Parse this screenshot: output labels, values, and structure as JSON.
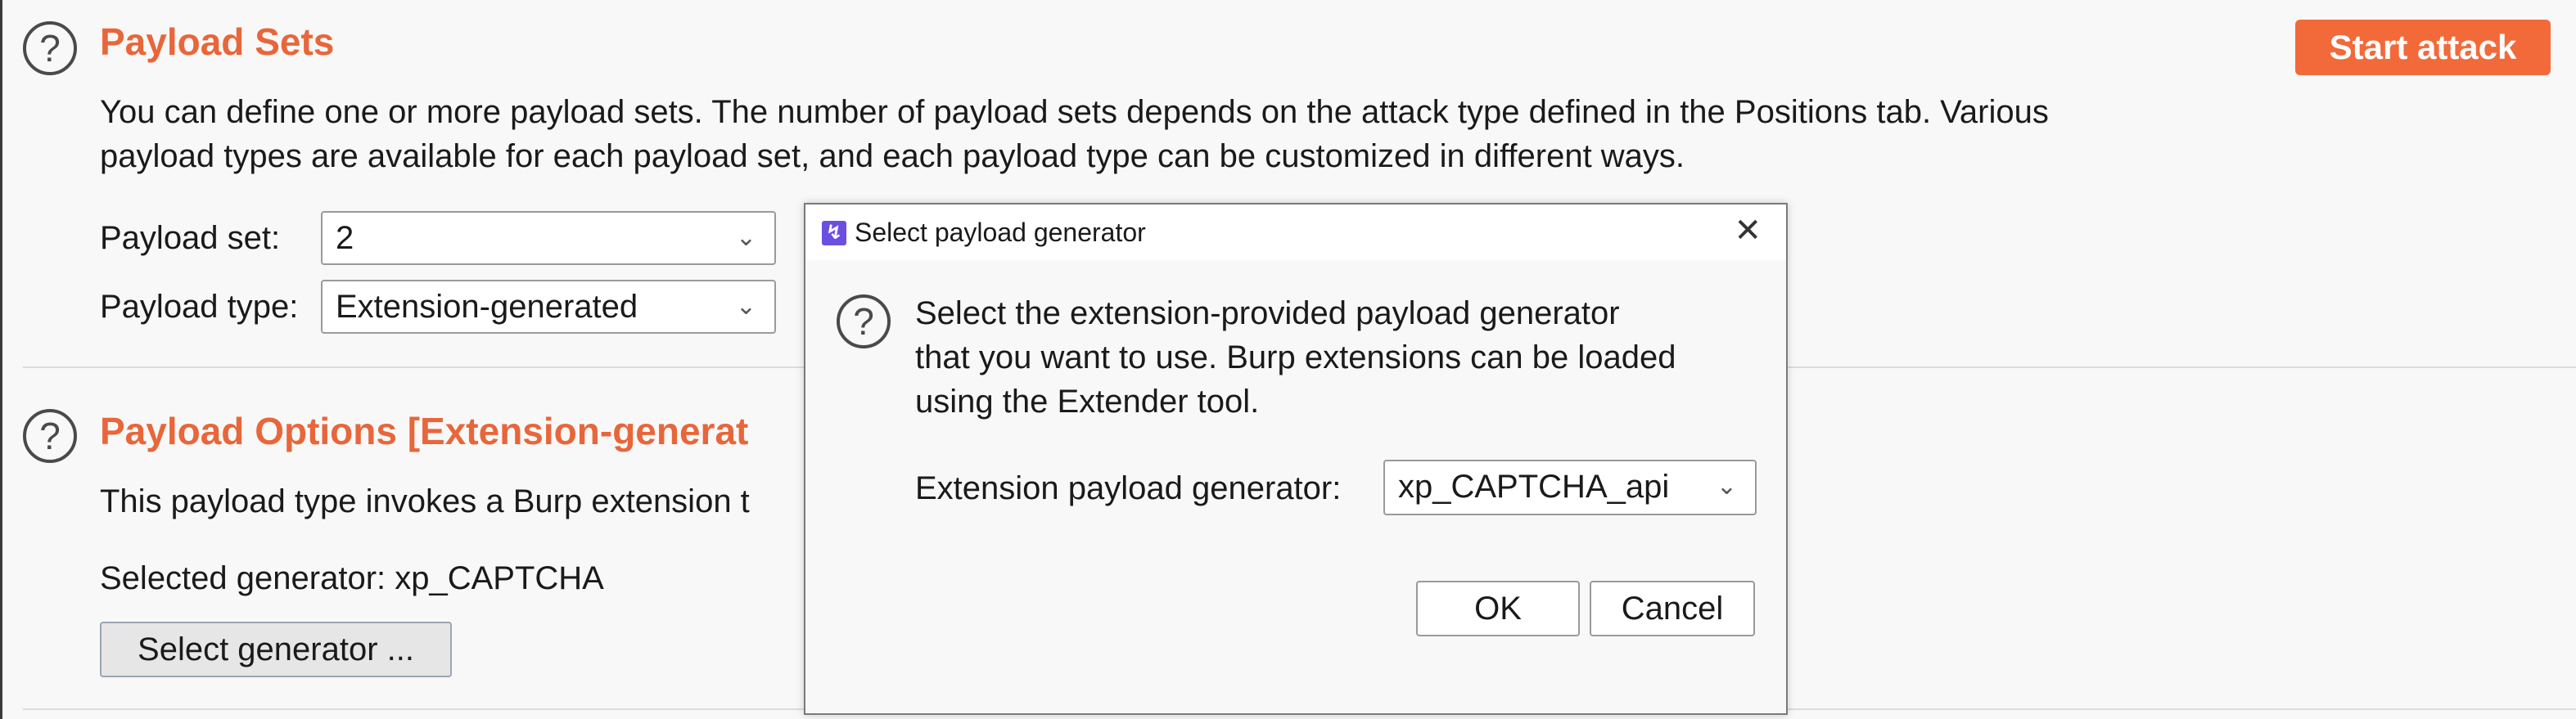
{
  "payload_sets": {
    "title": "Payload Sets",
    "description_line1": "You can define one or more payload sets. The number of payload sets depends on the attack type defined in the Positions tab. Various",
    "description_line2": "payload types are available for each payload set, and each payload type can be customized in different ways.",
    "set_label": "Payload set:",
    "set_value": "2",
    "type_label": "Payload type:",
    "type_value": "Extension-generated",
    "start_attack": "Start attack"
  },
  "payload_options": {
    "title": "Payload Options [Extension-generat",
    "description": "This payload type invokes a Burp extension t",
    "selected_label": "Selected generator: xp_CAPTCHA",
    "select_button": "Select generator ..."
  },
  "dialog": {
    "title": "Select payload generator",
    "message_line1": "Select the extension-provided payload generator",
    "message_line2": "that you want to use. Burp extensions can be loaded",
    "message_line3": "using the Extender tool.",
    "generator_label": "Extension payload generator:",
    "generator_value": "xp_CAPTCHA_api",
    "ok": "OK",
    "cancel": "Cancel"
  },
  "icons": {
    "help": "help-icon",
    "close": "close-icon",
    "dropdown": "chevron-down-icon",
    "app": "burp-app-icon"
  },
  "colors": {
    "accent": "#e8663a",
    "start_button": "#f26a3a",
    "app_icon": "#6a4fe0"
  }
}
